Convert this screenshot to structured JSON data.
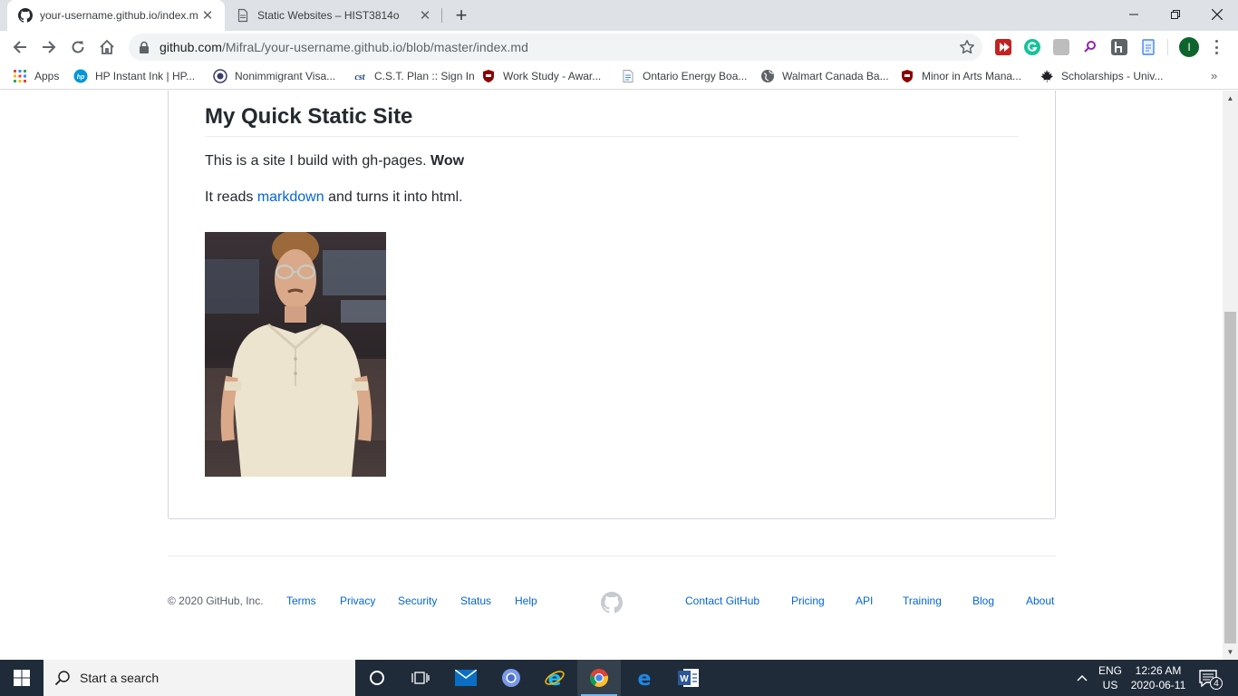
{
  "browser": {
    "tabs": [
      {
        "title": "your-username.github.io/index.m",
        "favicon": "github-icon",
        "active": true
      },
      {
        "title": "Static Websites – HIST3814o",
        "favicon": "document-icon",
        "active": false
      }
    ],
    "close_glyph": "✕",
    "new_tab_glyph": "+",
    "window_controls": {
      "minimize": "—",
      "restore": "❐",
      "close": "✕"
    },
    "url_host": "github.com",
    "url_path": "/MifraL/your-username.github.io/blob/master/index.md",
    "profile_initial": "I",
    "bookmarks": [
      {
        "label": "Apps",
        "icon": "apps-grid-icon"
      },
      {
        "label": "HP Instant Ink | HP...",
        "icon": "hp-icon"
      },
      {
        "label": "Nonimmigrant Visa...",
        "icon": "seal-icon"
      },
      {
        "label": "C.S.T. Plan :: Sign In",
        "icon": "cst-icon"
      },
      {
        "label": "Work Study - Awar...",
        "icon": "shield-icon"
      },
      {
        "label": "Ontario Energy Boa...",
        "icon": "document-icon"
      },
      {
        "label": "Walmart Canada Ba...",
        "icon": "globe-icon"
      },
      {
        "label": "Minor in Arts Mana...",
        "icon": "shield-icon"
      },
      {
        "label": "Scholarships - Univ...",
        "icon": "maple-leaf-icon"
      }
    ],
    "bookmarks_more": "»"
  },
  "readme": {
    "title": "My Quick Static Site",
    "p1_text": "This is a site I build with gh-pages. ",
    "p1_bold": "Wow",
    "p2_before": "It reads ",
    "p2_link": "markdown",
    "p2_after": " and turns it into html.",
    "image_alt": "animated gif of a person in a white polo shirt and glasses"
  },
  "footer": {
    "copyright": "© 2020 GitHub, Inc.",
    "left_links": [
      "Terms",
      "Privacy",
      "Security",
      "Status",
      "Help"
    ],
    "right_links": [
      "Contact GitHub",
      "Pricing",
      "API",
      "Training",
      "Blog",
      "About"
    ]
  },
  "taskbar": {
    "search_placeholder": "Start a search",
    "apps": [
      "cortana-icon",
      "task-view-icon",
      "mail-icon",
      "chrome-canary-icon",
      "internet-explorer-icon",
      "chrome-icon",
      "edge-icon",
      "word-icon"
    ],
    "language_line1": "ENG",
    "language_line2": "US",
    "time": "12:26 AM",
    "date": "2020-06-11",
    "notification_count": "4"
  },
  "colors": {
    "link": "#0366d6",
    "text": "#24292e",
    "taskbar": "#1f2b39",
    "tabstrip": "#dee1e6"
  }
}
